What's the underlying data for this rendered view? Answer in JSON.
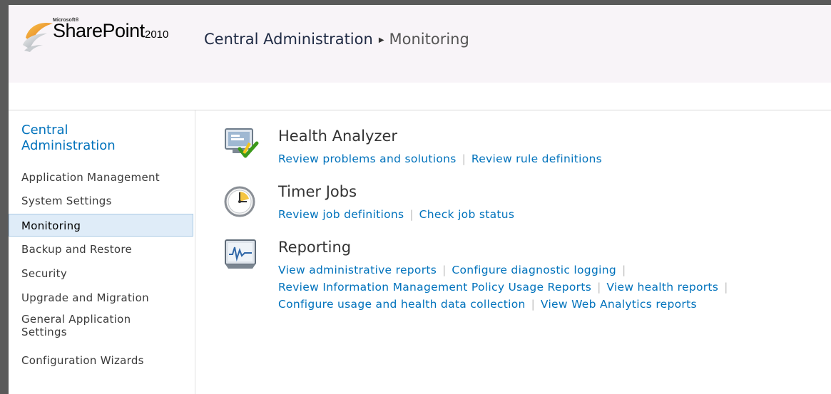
{
  "header": {
    "brand_small": "Microsoft®",
    "brand_name": "SharePoint",
    "brand_version": "2010",
    "breadcrumb_root": "Central Administration",
    "breadcrumb_current": "Monitoring"
  },
  "sidebar": {
    "heading": "Central Administration",
    "items": [
      {
        "label": "Application Management"
      },
      {
        "label": "System Settings"
      },
      {
        "label": "Monitoring",
        "selected": true
      },
      {
        "label": "Backup and Restore"
      },
      {
        "label": "Security"
      },
      {
        "label": "Upgrade and Migration"
      },
      {
        "label": "General Application Settings"
      },
      {
        "label": "Configuration Wizards"
      }
    ]
  },
  "sections": {
    "health": {
      "title": "Health Analyzer",
      "icon": "health-analyzer-icon",
      "links": [
        "Review problems and solutions",
        "Review rule definitions"
      ]
    },
    "timer": {
      "title": "Timer Jobs",
      "icon": "clock-icon",
      "links": [
        "Review job definitions",
        "Check job status"
      ]
    },
    "reporting": {
      "title": "Reporting",
      "icon": "chart-monitor-icon",
      "links": [
        "View administrative reports",
        "Configure diagnostic logging",
        "Review Information Management Policy Usage Reports",
        "View health reports",
        "Configure usage and health data collection",
        "View Web Analytics reports"
      ]
    }
  },
  "colors": {
    "link": "#0072bc",
    "selected_bg": "#dfecf8",
    "selected_border": "#a9c9e4"
  }
}
